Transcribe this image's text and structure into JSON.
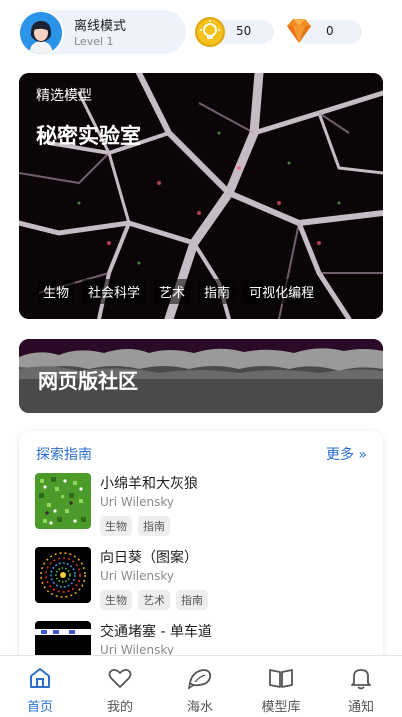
{
  "profile": {
    "name": "离线模式",
    "level": "Level 1",
    "avatar_icon": "user-avatar"
  },
  "currency": {
    "coins": "50",
    "gems": "0",
    "coin_icon": "lightbulb-coin-icon",
    "gem_icon": "diamond-icon"
  },
  "featured": {
    "label": "精选模型",
    "title": "秘密实验室",
    "tags": [
      "生物",
      "社会科学",
      "艺术",
      "指南",
      "可视化编程"
    ]
  },
  "community": {
    "title": "网页版社区"
  },
  "guide": {
    "header": "探索指南",
    "more": "更多 »",
    "items": [
      {
        "title": "小绵羊和大灰狼",
        "author": "Uri Wilensky",
        "tags": [
          "生物",
          "指南"
        ]
      },
      {
        "title": "向日葵（图案）",
        "author": "Uri Wilensky",
        "tags": [
          "生物",
          "艺术",
          "指南"
        ]
      },
      {
        "title": "交通堵塞 - 单车道",
        "author": "Uri Wilensky",
        "tags": []
      }
    ]
  },
  "nav": {
    "items": [
      {
        "label": "首页",
        "icon": "home-icon",
        "active": true
      },
      {
        "label": "我的",
        "icon": "heart-icon"
      },
      {
        "label": "海水",
        "icon": "shell-icon"
      },
      {
        "label": "模型库",
        "icon": "book-icon"
      },
      {
        "label": "通知",
        "icon": "bell-icon"
      }
    ]
  },
  "colors": {
    "accent": "#2a6fcf",
    "pill_bg": "#eef2fb",
    "coin": "#f4c21a",
    "gem": "#f28c1c"
  }
}
